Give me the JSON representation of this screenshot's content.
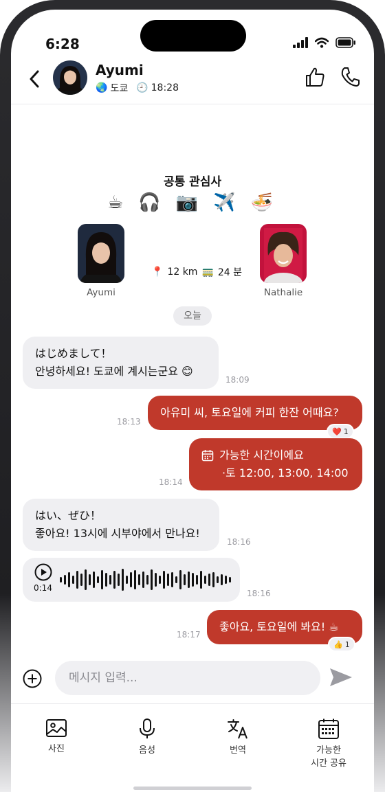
{
  "status": {
    "time": "6:28"
  },
  "header": {
    "name": "Ayumi",
    "location": "도쿄",
    "local_time": "18:28",
    "globe_emoji": "🌏",
    "clock_emoji": "🕘"
  },
  "interests": {
    "title": "공통 관심사",
    "items": [
      "☕",
      "🎧",
      "📷",
      "✈️",
      "🍜"
    ]
  },
  "profiles": {
    "left_name": "Ayumi",
    "right_name": "Nathalie",
    "pin_emoji": "📍",
    "distance": "12 km",
    "train_emoji": "🚃",
    "duration": "24 분"
  },
  "date_pill": "오늘",
  "messages": [
    {
      "line1": "はじめまして！",
      "line2": "안녕하세요! 도쿄에 계시는군요 😊",
      "time": "18:09"
    },
    {
      "text": "아유미 씨, 토요일에 커피 한잔 어때요?",
      "time": "18:13",
      "reaction_emoji": "❤️",
      "reaction_count": "1"
    },
    {
      "line1": "가능한 시간이에요",
      "line2": "·토 12:00, 13:00, 14:00",
      "time": "18:14"
    },
    {
      "line1": "はい、ぜひ！",
      "line2": "좋아요! 13시에 시부야에서 만나요!",
      "time": "18:16"
    },
    {
      "duration": "0:14",
      "time": "18:16"
    },
    {
      "text": "좋아요, 토요일에 봐요! ☕",
      "time": "18:17",
      "reaction_emoji": "👍",
      "reaction_count": "1"
    }
  ],
  "composer": {
    "placeholder": "메시지 입력..."
  },
  "toolbar": {
    "photo": "사진",
    "voice": "음성",
    "translate": "번역",
    "availability_line1": "가능한",
    "availability_line2": "시간 공유"
  },
  "colors": {
    "accent": "#c0392b",
    "incoming_bubble": "#efeff2"
  }
}
